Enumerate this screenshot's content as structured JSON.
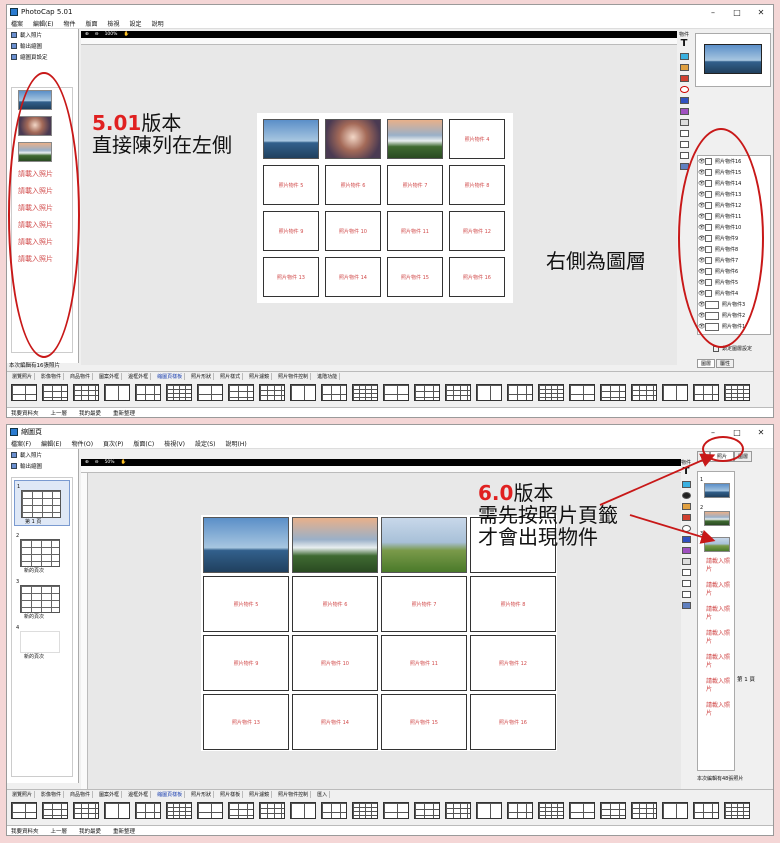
{
  "w1": {
    "title": "PhotoCap 5.01",
    "menu": [
      "檔案",
      "編輯(E)",
      "物件",
      "版面",
      "檢視",
      "設定",
      "說明"
    ],
    "left_buttons": [
      "載入照片",
      "輸出縮圖",
      "縮圖頁設定"
    ],
    "thumb_placeholder": "請載入照片",
    "status_count": "本次編輯有16張照片",
    "toolbar_zoom": "100%",
    "cells": [
      "",
      "",
      "",
      "照片物件 4",
      "照片物件 5",
      "照片物件 6",
      "照片物件 7",
      "照片物件 8",
      "照片物件 9",
      "照片物件 10",
      "照片物件 11",
      "照片物件 12",
      "照片物件 13",
      "照片物件 14",
      "照片物件 15",
      "照片物件 16"
    ],
    "layers": [
      "照片物件16",
      "照片物件15",
      "照片物件14",
      "照片物件13",
      "照片物件12",
      "照片物件11",
      "照片物件10",
      "照片物件9",
      "照片物件8",
      "照片物件7",
      "照片物件6",
      "照片物件5",
      "照片物件4",
      "照片物件3",
      "照片物件2",
      "照片物件1"
    ],
    "layer_option": "鎖定圖層設定",
    "right_tabs": [
      "圖層",
      "屬性"
    ],
    "tabs": [
      "瀏覽照片",
      "影像物件",
      "商品物件",
      "圖案外框",
      "邊框外框",
      "縮圖頁樣板",
      "照片形狀",
      "照片樣式",
      "照片濾鏡",
      "照片物件控制",
      "進階功能"
    ],
    "status_links": [
      "我要資料夾",
      "上一層",
      "我的最愛",
      "重新整理"
    ],
    "annot_left_num": "5.01",
    "annot_left_rest": "版本",
    "annot_left_line2": "直接陳列在左側",
    "annot_right": "右側為圖層"
  },
  "w2": {
    "title": "縮圖頁",
    "menu": [
      "檔案(F)",
      "編輯(E)",
      "物件(O)",
      "頁次(P)",
      "版面(C)",
      "檢視(V)",
      "設定(S)",
      "說明(H)"
    ],
    "left_buttons": [
      "載入照片",
      "輸出縮圖"
    ],
    "pages": [
      "第 1 頁",
      "新的頁次",
      "新的頁次",
      "新的頁次"
    ],
    "page_nums": [
      "1",
      "2",
      "3",
      "4"
    ],
    "toolbar_zoom": "50%",
    "cells": [
      "",
      "",
      "",
      "",
      "照片物件 5",
      "照片物件 6",
      "照片物件 7",
      "照片物件 8",
      "照片物件 9",
      "照片物件 10",
      "照片物件 11",
      "照片物件 12",
      "照片物件 13",
      "照片物件 14",
      "照片物件 15",
      "照片物件 16"
    ],
    "right_tabs": [
      "頁",
      "照片",
      "圖層"
    ],
    "thumb_placeholder": "請載入照片",
    "page_label": "第 1 頁",
    "status_count": "本次編輯有48張照片",
    "tabs": [
      "瀏覽照片",
      "影像物件",
      "商品物件",
      "圖案外框",
      "邊框外框",
      "縮圖頁樣板",
      "照片形狀",
      "照片樣板",
      "照片濾鏡",
      "照片物件控制",
      "匯入"
    ],
    "status_links": [
      "我要資料夾",
      "上一層",
      "我的最愛",
      "重新整理"
    ],
    "annot_num": "6.0",
    "annot_rest": "版本",
    "annot_line2": "需先按照片頁籤",
    "annot_line3": "才會出現物件"
  },
  "colors": {
    "annotation_red": "#e02020",
    "placeholder_red": "#d14b4b",
    "oval_red": "#c81818"
  }
}
